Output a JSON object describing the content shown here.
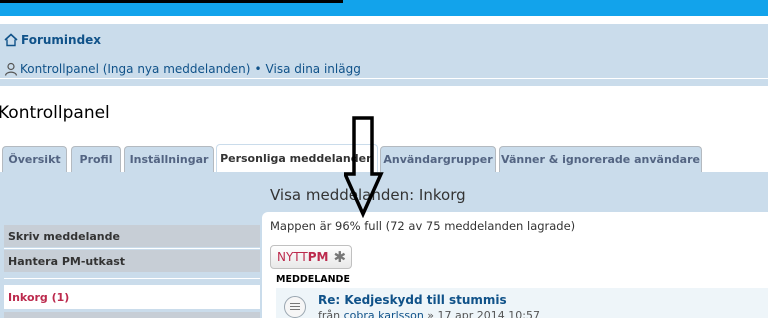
{
  "breadcrumb": {
    "home_label": "Forumindex",
    "control_panel_text": "Kontrollpanel (Inga nya meddelanden)",
    "separator": "•",
    "view_posts_text": "Visa dina inlägg"
  },
  "page_title": "Kontrollpanel",
  "tabs": [
    {
      "label": "Översikt"
    },
    {
      "label": "Profil"
    },
    {
      "label": "Inställningar"
    },
    {
      "label": "Personliga meddelanden"
    },
    {
      "label": "Användargrupper"
    },
    {
      "label": "Vänner & ignorerade användare"
    }
  ],
  "sidebar": {
    "items": [
      {
        "label": "Skriv meddelande"
      },
      {
        "label": "Hantera PM-utkast"
      },
      {
        "label": "Inkorg (1)"
      }
    ]
  },
  "content": {
    "title": "Visa meddelanden: Inkorg",
    "mailbox_status": "Mappen är 96% full (72 av 75 meddelanden lagrade)",
    "new_pm": {
      "part1": "NYTT",
      "part2": "PM",
      "icon": "star-icon"
    },
    "column_header": "MEDDELANDE",
    "message": {
      "subject": "Re: Kedjeskydd till stummis",
      "from_prefix": "från",
      "author": "cobra karlsson",
      "date": "» 17 apr 2014 10:57"
    }
  },
  "colors": {
    "accent": "#12a3eb",
    "navbar": "#cadceb",
    "link": "#105289",
    "inbox": "#bc2a4d"
  }
}
